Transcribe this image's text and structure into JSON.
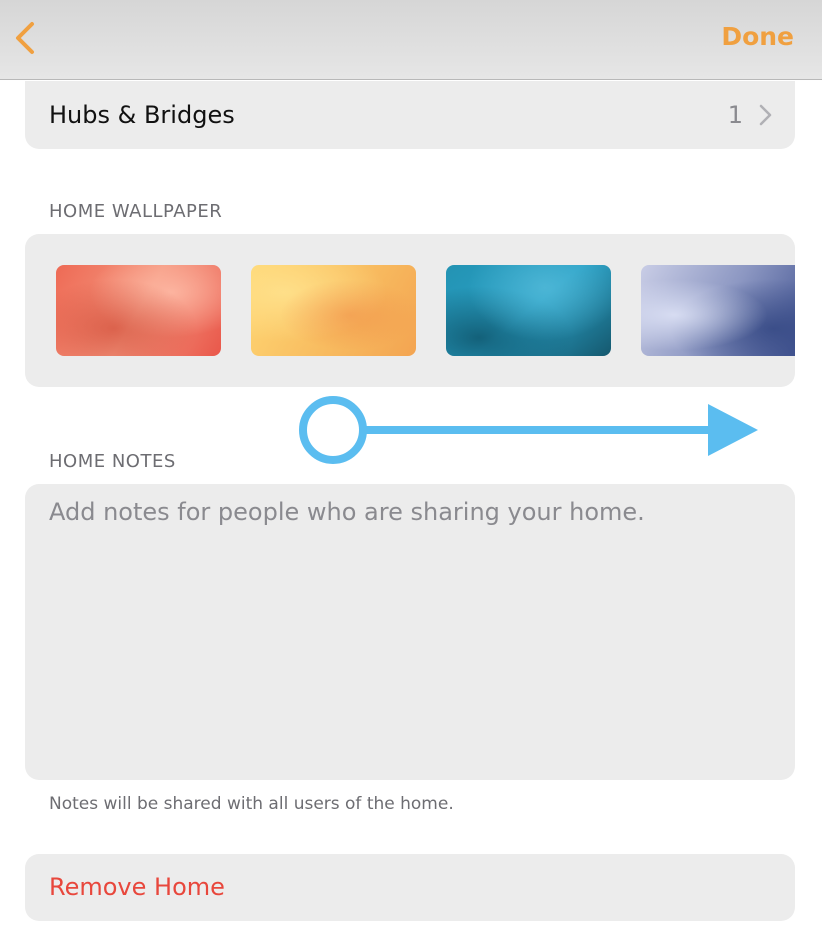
{
  "nav": {
    "back_icon": "chevron-left-icon",
    "done_label": "Done",
    "accent_color": "#f0a040"
  },
  "hubs": {
    "label": "Hubs & Bridges",
    "count": "1",
    "chevron_icon": "chevron-right-icon"
  },
  "wallpaper": {
    "header": "HOME WALLPAPER",
    "thumbnails": [
      "coral",
      "yellow",
      "teal",
      "periwinkle"
    ]
  },
  "notes": {
    "header": "HOME NOTES",
    "placeholder": "Add notes for people who are sharing your home.",
    "footer": "Notes will be shared with all users of the home."
  },
  "remove": {
    "label": "Remove Home",
    "color": "#e8473c"
  },
  "swipe": {
    "icon": "swipe-right-arrow-icon",
    "color": "#5bbdf0"
  }
}
